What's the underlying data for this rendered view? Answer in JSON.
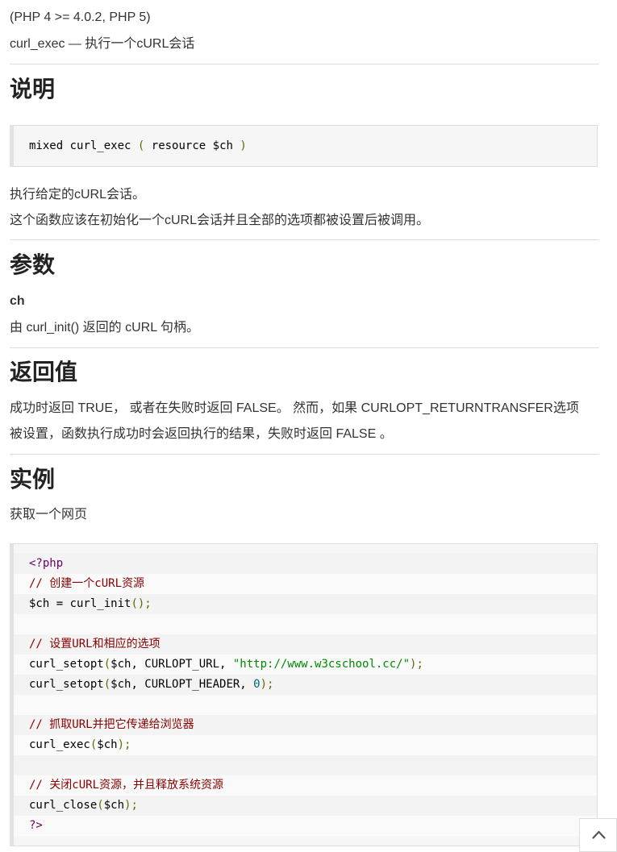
{
  "header": {
    "version": "(PHP 4 >= 4.0.2, PHP 5)",
    "summary": "curl_exec — 执行一个cURL会话"
  },
  "description": {
    "heading": "说明",
    "signature": {
      "ret": "mixed",
      "name": "curl_exec",
      "open": "(",
      "type": "resource",
      "param": "$ch",
      "close": ")"
    },
    "text1": "执行给定的cURL会话。",
    "text2": "这个函数应该在初始化一个cURL会话并且全部的选项都被设置后被调用。"
  },
  "parameters": {
    "heading": "参数",
    "name": "ch",
    "text": "由 curl_init() 返回的 cURL 句柄。"
  },
  "return_values": {
    "heading": "返回值",
    "line1": "成功时返回 TRUE， 或者在失败时返回 FALSE。 然而，如果 CURLOPT_RETURNTRANSFER选项",
    "line2": "被设置，函数执行成功时会返回执行的结果，失败时返回 FALSE 。"
  },
  "example": {
    "heading": "实例",
    "caption": "获取一个网页",
    "code": {
      "l1": "<?php",
      "l2": "// 创建一个cURL资源",
      "l3a": "$ch = curl_init",
      "l3b": "();",
      "l5": "// 设置URL和相应的选项",
      "l6a": "curl_setopt",
      "l6b": "(",
      "l6c": "$ch, CURLOPT_URL, ",
      "l6d": "\"http://www.w3cschool.cc/\"",
      "l6e": ");",
      "l7a": "curl_setopt",
      "l7b": "(",
      "l7c": "$ch, CURLOPT_HEADER, ",
      "l7d": "0",
      "l7e": ");",
      "l9": "// 抓取URL并把它传递给浏览器",
      "l10a": "curl_exec",
      "l10b": "(",
      "l10c": "$ch",
      "l10d": ");",
      "l12": "// 关闭cURL资源，并且释放系统资源",
      "l13a": "curl_close",
      "l13b": "(",
      "l13c": "$ch",
      "l13d": ");",
      "l14": "?>"
    }
  },
  "back_to_top": {
    "icon": "chevron-up-icon"
  },
  "colors": {
    "comment": "#880000",
    "string": "#008800",
    "number": "#006666",
    "punctuation": "#666600",
    "tag": "#660066"
  }
}
